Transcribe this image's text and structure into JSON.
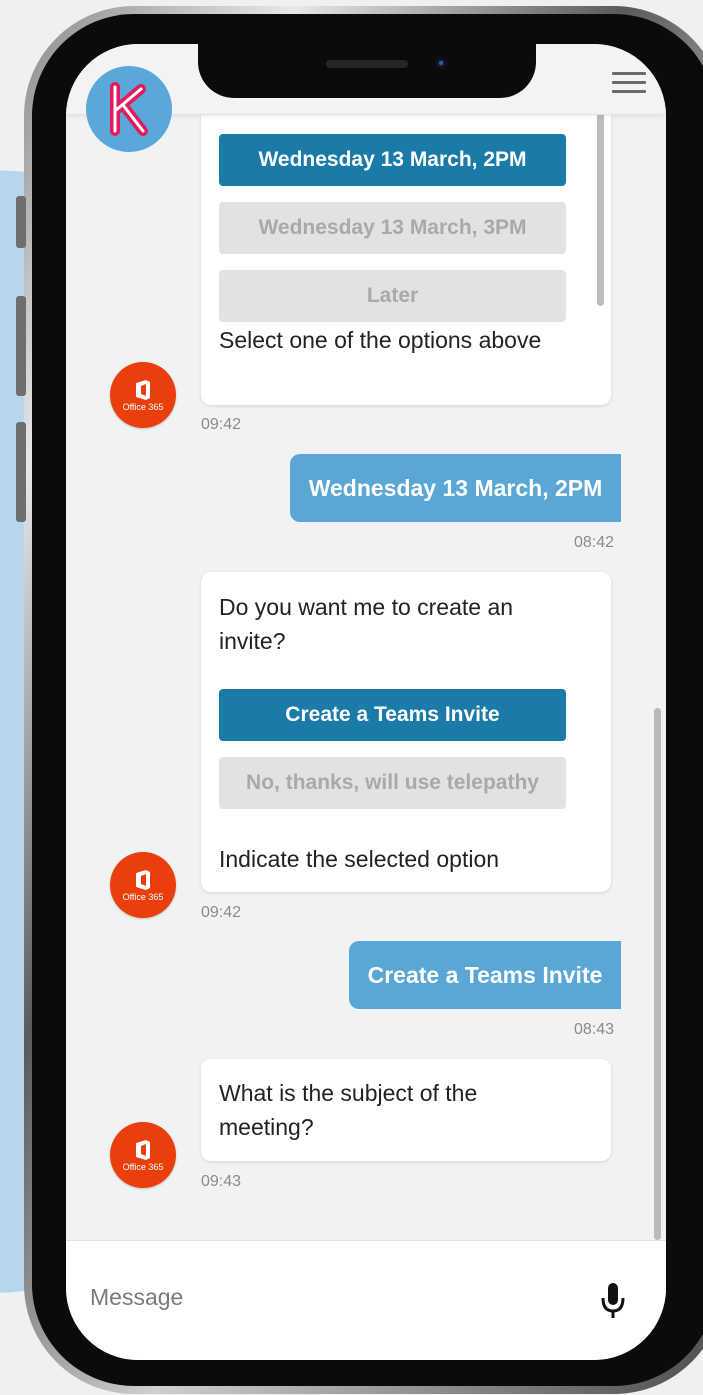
{
  "app": {
    "logo_letter": "K"
  },
  "bot": {
    "avatar_label": "Office 365"
  },
  "messages": {
    "m1": {
      "options": [
        {
          "label": "Wednesday 13 March, 2PM",
          "state": "selected"
        },
        {
          "label": "Wednesday 13 March, 3PM",
          "state": "idle"
        },
        {
          "label": "Later",
          "state": "idle"
        }
      ],
      "instruction": "Select one of the options above",
      "time": "09:42"
    },
    "u1": {
      "text": "Wednesday 13 March, 2PM",
      "time": "08:42"
    },
    "m2": {
      "question": "Do you want me to create an invite?",
      "options": [
        {
          "label": "Create a Teams Invite",
          "state": "selected"
        },
        {
          "label": "No, thanks, will use telepathy",
          "state": "idle"
        }
      ],
      "instruction": "Indicate the selected option",
      "time": "09:42"
    },
    "u2": {
      "text": "Create a Teams Invite",
      "time": "08:43"
    },
    "m3": {
      "question": "What is the subject of the meeting?",
      "time": "09:43"
    }
  },
  "composer": {
    "placeholder": "Message"
  },
  "colors": {
    "brand_blue": "#5aa7dc",
    "logo_pink": "#e4185a",
    "selected_option": "#1b7ba8",
    "user_bubble": "#5aa7d6",
    "office_red": "#ea3e0c",
    "idle_option": "#e2e2e2"
  },
  "icons": {
    "logo": "k-logo-icon",
    "menu": "hamburger-menu-icon",
    "bot": "office-365-icon",
    "mic": "microphone-icon"
  }
}
